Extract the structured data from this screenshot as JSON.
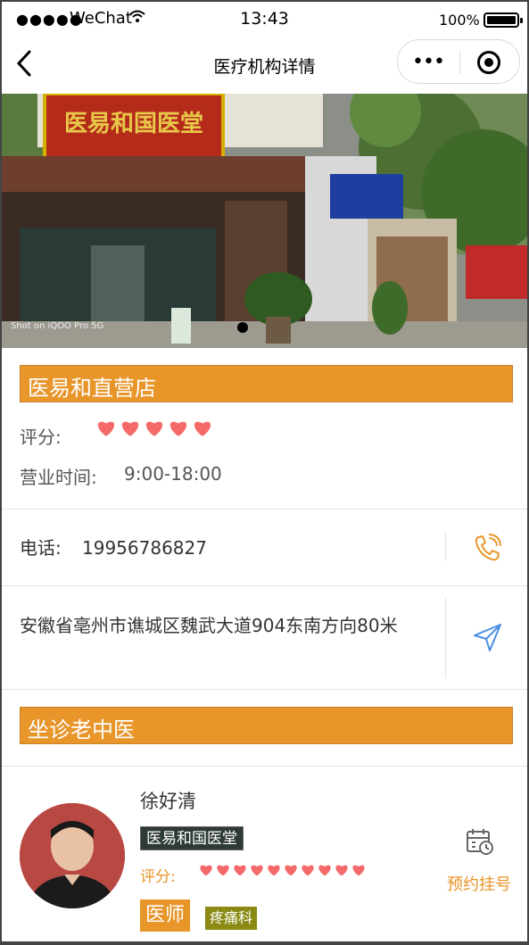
{
  "status_bar": {
    "carrier": "WeChat",
    "time": "13:43",
    "battery": "100%"
  },
  "nav": {
    "title": "医疗机构详情"
  },
  "store": {
    "name": "医易和直营店",
    "rating_label": "评分:",
    "rating_value": 5,
    "hours_label": "营业时间:",
    "hours": "9:00-18:00",
    "phone_label": "电话:",
    "phone": "19956786827",
    "address": "安徽省亳州市谯城区魏武大道904东南方向80米"
  },
  "banner": {
    "signboard": "医易和国医堂",
    "camera_mark": "Shot on iQOO Pro 5G"
  },
  "doctors_section": {
    "title": "坐诊老中医"
  },
  "doctor": {
    "name": "徐好清",
    "org": "医易和国医堂",
    "rating_label": "评分:",
    "rating_value": 10,
    "title": "医师",
    "department": "疼痛科",
    "book_label": "预约挂号"
  },
  "colors": {
    "accent": "#e8952a",
    "heart": "#f46a6a"
  }
}
